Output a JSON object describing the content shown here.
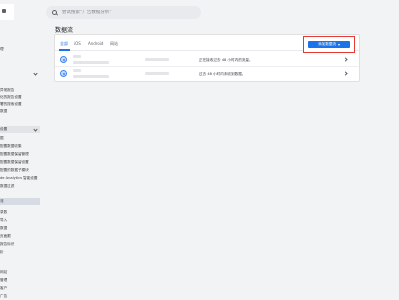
{
  "search": {
    "placeholder": "尝试搜索“广告数据分析”"
  },
  "sidebar": {
    "items": [
      {
        "label": "理"
      },
      {
        "label": "异常报告"
      },
      {
        "label": "化的报告设置"
      },
      {
        "label": "署的搜索设置"
      },
      {
        "label": "数据"
      },
      {
        "label": "设置"
      },
      {
        "label": "据"
      },
      {
        "label": "配置数据收集"
      },
      {
        "label": "配置数据保留管理"
      },
      {
        "label": "配置数据保留设置"
      },
      {
        "label": "配置的数据子模块"
      },
      {
        "label": "de Analytics 智能设置"
      },
      {
        "label": "数据过滤"
      },
      {
        "label": "流"
      },
      {
        "label": "录数"
      },
      {
        "label": "导入"
      },
      {
        "label": "数据"
      },
      {
        "label": "页面跟"
      },
      {
        "label": "报告标识"
      },
      {
        "label": "析"
      },
      {
        "label": "网站"
      },
      {
        "label": "管理"
      },
      {
        "label": "客户"
      },
      {
        "label": "广告"
      }
    ]
  },
  "page": {
    "title": "数据流"
  },
  "tabs": [
    {
      "label": "全部"
    },
    {
      "label": "iOS"
    },
    {
      "label": "Android"
    },
    {
      "label": "网站"
    }
  ],
  "add_stream_button": {
    "label": "添加数据流"
  },
  "streams": [
    {
      "status": "正在接收过去 48 小时内的流量。"
    },
    {
      "status": "过去 48 小时内未收到数据。"
    }
  ],
  "colors": {
    "accent": "#1a73e8",
    "button_outline": "#e53935"
  }
}
